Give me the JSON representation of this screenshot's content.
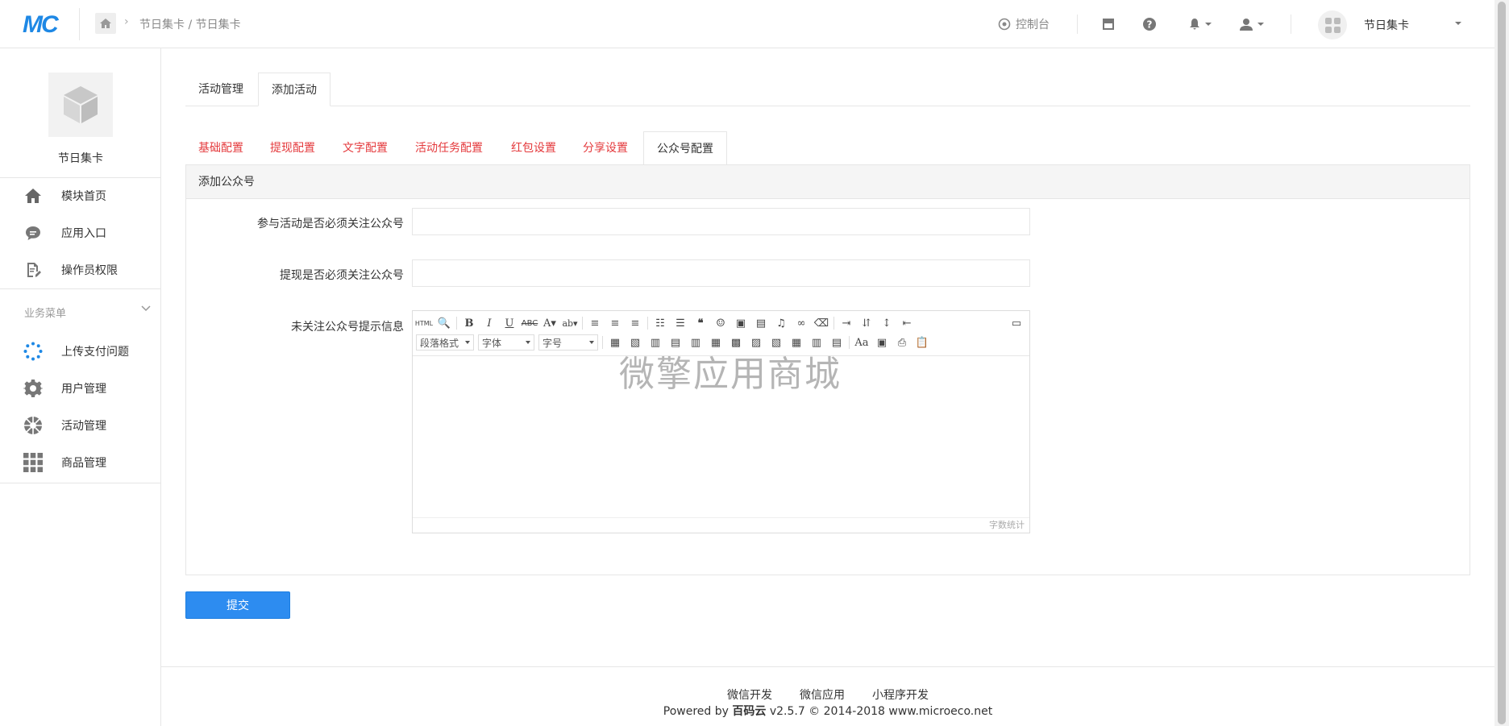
{
  "header": {
    "logo": "MC",
    "breadcrumb": "节日集卡 / 节日集卡",
    "dashboard_label": "控制台",
    "app_name": "节日集卡"
  },
  "sidebar": {
    "title": "节日集卡",
    "items": [
      {
        "label": "模块首页",
        "icon": "home-icon"
      },
      {
        "label": "应用入口",
        "icon": "chat-icon"
      },
      {
        "label": "操作员权限",
        "icon": "document-edit-icon"
      }
    ],
    "section_title": "业务菜单",
    "business_items": [
      {
        "label": "上传支付问题",
        "icon": "spinner-icon"
      },
      {
        "label": "用户管理",
        "icon": "gear-icon"
      },
      {
        "label": "活动管理",
        "icon": "aperture-icon"
      },
      {
        "label": "商品管理",
        "icon": "grid-icon"
      }
    ]
  },
  "main": {
    "tabs": [
      "活动管理",
      "添加活动"
    ],
    "active_tab": 1,
    "sub_tabs": [
      "基础配置",
      "提现配置",
      "文字配置",
      "活动任务配置",
      "红包设置",
      "分享设置",
      "公众号配置"
    ],
    "active_sub_tab": 6,
    "panel_title": "添加公众号",
    "fields": {
      "follow_required_label": "参与活动是否必须关注公众号",
      "follow_required_value": "",
      "withdraw_follow_label": "提现是否必须关注公众号",
      "withdraw_follow_value": "",
      "unfollow_tip_label": "未关注公众号提示信息"
    },
    "editor": {
      "paragraph_combo": "段落格式",
      "font_combo": "字体",
      "size_combo": "字号",
      "word_count": "字数统计",
      "watermark": "微擎应用商城"
    },
    "submit_label": "提交"
  },
  "footer": {
    "links": [
      "微信开发",
      "微信应用",
      "小程序开发"
    ],
    "powered_prefix": "Powered by",
    "brand": "百码云",
    "powered_suffix": "v2.5.7 © 2014-2018 www.microeco.net"
  },
  "colors": {
    "accent": "#2d8cf0",
    "sub_tab_red": "#e4393c",
    "logo_blue": "#1e88e5"
  }
}
